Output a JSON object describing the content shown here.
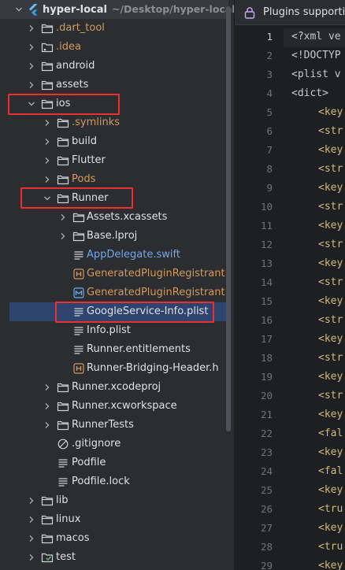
{
  "project": {
    "name": "hyper-local",
    "path": "~/Desktop/hyper-local"
  },
  "tree": [
    {
      "label": "hyper-local",
      "hint": "~/Desktop/hyper-local",
      "icon": "flutter",
      "chevron": "down",
      "color": "default"
    },
    {
      "label": ".dart_tool",
      "icon": "folder",
      "chevron": "right",
      "color": "orange"
    },
    {
      "label": ".idea",
      "icon": "folder-config",
      "chevron": "right",
      "color": "orange"
    },
    {
      "label": "android",
      "icon": "folder",
      "chevron": "right",
      "color": "default"
    },
    {
      "label": "assets",
      "icon": "folder",
      "chevron": "right",
      "color": "default"
    },
    {
      "label": "ios",
      "icon": "folder",
      "chevron": "down",
      "color": "default"
    },
    {
      "label": ".symlinks",
      "icon": "folder",
      "chevron": "right",
      "color": "orange"
    },
    {
      "label": "build",
      "icon": "folder",
      "chevron": "right",
      "color": "default"
    },
    {
      "label": "Flutter",
      "icon": "folder",
      "chevron": "right",
      "color": "default"
    },
    {
      "label": "Pods",
      "icon": "folder",
      "chevron": "right",
      "color": "orange"
    },
    {
      "label": "Runner",
      "icon": "folder",
      "chevron": "down",
      "color": "default"
    },
    {
      "label": "Assets.xcassets",
      "icon": "folder",
      "chevron": "right",
      "color": "default"
    },
    {
      "label": "Base.lproj",
      "icon": "folder",
      "chevron": "right",
      "color": "default"
    },
    {
      "label": "AppDelegate.swift",
      "icon": "text-file",
      "color": "blue"
    },
    {
      "label": "GeneratedPluginRegistrant.",
      "icon": "h-file",
      "color": "orange"
    },
    {
      "label": "GeneratedPluginRegistrant.",
      "icon": "m-file",
      "color": "orange"
    },
    {
      "label": "GoogleService-Info.plist",
      "icon": "text-file",
      "color": "default"
    },
    {
      "label": "Info.plist",
      "icon": "text-file",
      "color": "default"
    },
    {
      "label": "Runner.entitlements",
      "icon": "text-file",
      "color": "default"
    },
    {
      "label": "Runner-Bridging-Header.h",
      "icon": "h-file",
      "color": "default"
    },
    {
      "label": "Runner.xcodeproj",
      "icon": "folder",
      "chevron": "right",
      "color": "default"
    },
    {
      "label": "Runner.xcworkspace",
      "icon": "folder",
      "chevron": "right",
      "color": "default"
    },
    {
      "label": "RunnerTests",
      "icon": "folder",
      "chevron": "right",
      "color": "default"
    },
    {
      "label": ".gitignore",
      "icon": "ignore-file",
      "color": "default"
    },
    {
      "label": "Podfile",
      "icon": "text-file",
      "color": "default"
    },
    {
      "label": "Podfile.lock",
      "icon": "text-file",
      "color": "default"
    },
    {
      "label": "lib",
      "icon": "folder",
      "chevron": "right",
      "color": "default"
    },
    {
      "label": "linux",
      "icon": "folder",
      "chevron": "right",
      "color": "default"
    },
    {
      "label": "macos",
      "icon": "folder",
      "chevron": "right",
      "color": "default"
    },
    {
      "label": "test",
      "icon": "folder-test",
      "chevron": "right",
      "color": "default"
    }
  ],
  "editor": {
    "banner": "Plugins supporting",
    "line_numbers": [
      "1",
      "2",
      "3",
      "4",
      "5",
      "6",
      "7",
      "8",
      "9",
      "10",
      "11",
      "12",
      "13",
      "14",
      "15",
      "16",
      "17",
      "18",
      "19",
      "20",
      "21",
      "22",
      "23",
      "24",
      "25",
      "26",
      "27",
      "28",
      "29"
    ],
    "lines": [
      "<?xml ve",
      "<!DOCTYP",
      "<plist v",
      "<dict>",
      "<key",
      "<str",
      "<key",
      "<str",
      "<key",
      "<str",
      "<key",
      "<str",
      "<key",
      "<str",
      "<key",
      "<str",
      "<key",
      "<str",
      "<key",
      "<str",
      "<key",
      "<fal",
      "<key",
      "<fal",
      "<key",
      "<tru",
      "<key",
      "<tru",
      "<key"
    ]
  },
  "colors": {
    "accent_selection": "#2e436e",
    "highlight_box": "#e8302d",
    "orange_text": "#d49a5c",
    "blue_text": "#6fa8f2"
  }
}
